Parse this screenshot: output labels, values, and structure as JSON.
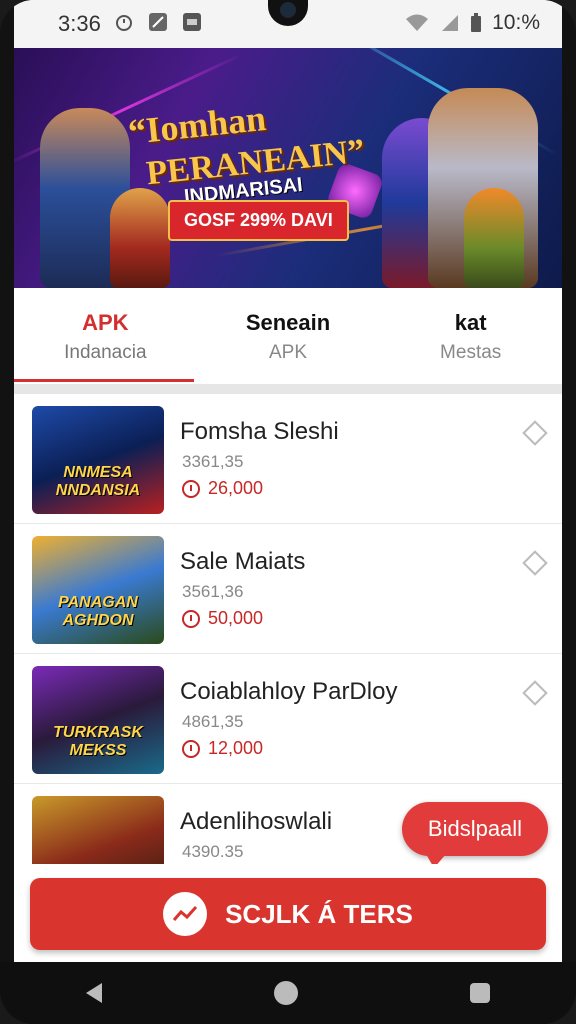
{
  "status_bar": {
    "time": "3:36",
    "battery": "10:%"
  },
  "banner": {
    "title_line1": "“Iomhan",
    "title_line2": "PERANEAIN”",
    "title_line3": "INDMARISAI",
    "promo": "GOSF 299% DAVI"
  },
  "tabs": [
    {
      "label": "APK",
      "sub": "Indanacia"
    },
    {
      "label": "Seneain",
      "sub": "APK"
    },
    {
      "label": "kat",
      "sub": "Mestas"
    }
  ],
  "items": [
    {
      "title": "Fomsha Sleshi",
      "sub": "3361,35",
      "price": "26,000",
      "thumb_text": "NNMESA NNDANSIA"
    },
    {
      "title": "Sale Maiats",
      "sub": "3561,36",
      "price": "50,000",
      "thumb_text": "PANAGAN AGHDON"
    },
    {
      "title": "Coiablahloy ParDloy",
      "sub": "4861,35",
      "price": "12,000",
      "thumb_text": "TURKRASK MEKSS"
    },
    {
      "title": "Adenlihoswlali",
      "sub": "4390.35",
      "price": "",
      "thumb_text": ""
    }
  ],
  "chat_bubble": "Bidslpaall",
  "cta_label": "SCJLK Á TERS",
  "colors": {
    "accent": "#d9342e",
    "active_tab": "#d32f2f"
  }
}
